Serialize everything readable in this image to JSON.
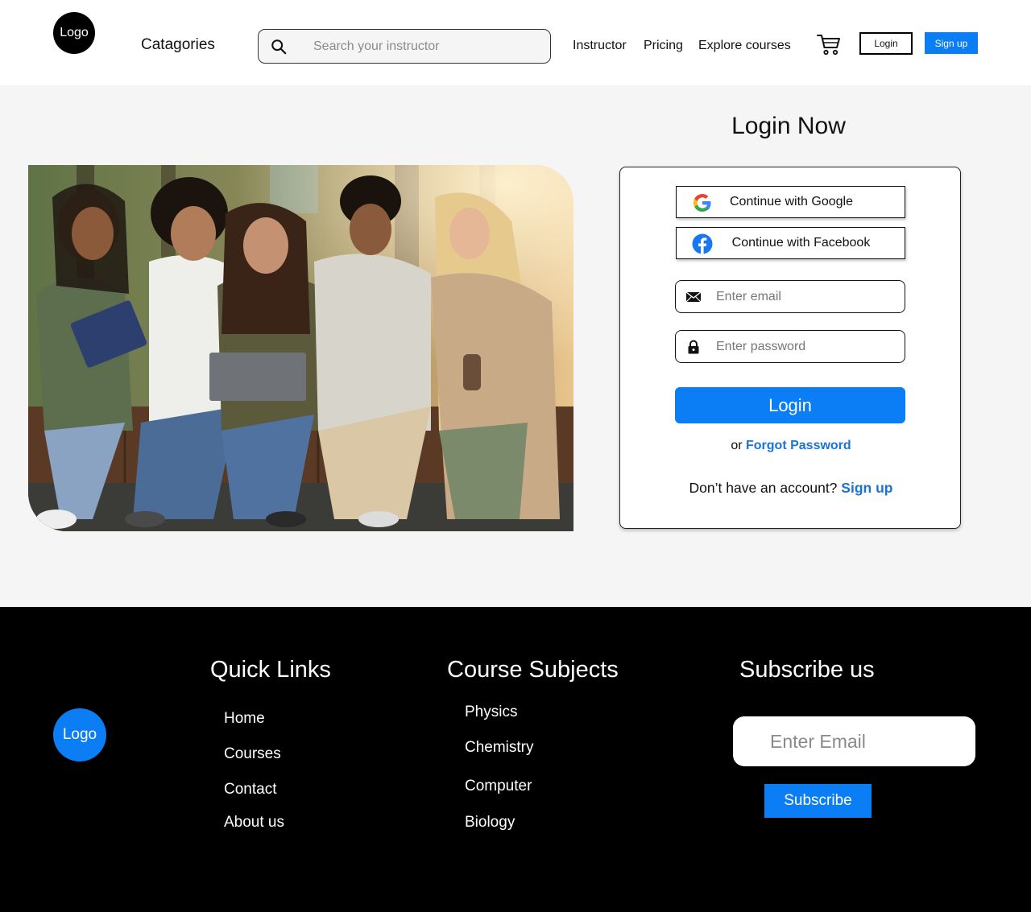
{
  "header": {
    "logo_label": "Logo",
    "categories_label": "Catagories",
    "search": {
      "placeholder": "Search your instructor",
      "value": ""
    },
    "nav": [
      {
        "label": "Instructor"
      },
      {
        "label": "Pricing"
      },
      {
        "label": "Explore courses"
      }
    ],
    "cart_icon": "cart-icon",
    "login_label": "Login",
    "signup_label": "Sign up"
  },
  "main": {
    "hero_image": "group-of-five-students-sitting-on-bench-with-laptop-and-book",
    "login_title": "Login Now",
    "card": {
      "google_label": "Continue with Google",
      "facebook_label": "Continue with Facebook",
      "email": {
        "placeholder": "Enter email",
        "value": "",
        "icon": "envelope-icon"
      },
      "password": {
        "placeholder": "Enter password",
        "value": "",
        "icon": "lock-icon"
      },
      "login_button": "Login",
      "or_text": "or",
      "forgot_link": "Forgot Password",
      "no_account_text": "Don’t have an account?",
      "signup_link": "Sign up"
    }
  },
  "footer": {
    "logo_label": "Logo",
    "quick_links": {
      "heading": "Quick Links",
      "items": [
        "Home",
        "Courses",
        "Contact",
        "About us"
      ]
    },
    "course_subjects": {
      "heading": "Course Subjects",
      "items": [
        "Physics",
        "Chemistry",
        "Computer",
        "Biology"
      ]
    },
    "subscribe": {
      "heading": "Subscribe us",
      "email_placeholder": "Enter Email",
      "button_label": "Subscribe"
    }
  },
  "colors": {
    "accent": "#0b7df5",
    "link": "#1a73d9",
    "main_bg": "#f5f5f5",
    "footer_bg": "#000000"
  }
}
